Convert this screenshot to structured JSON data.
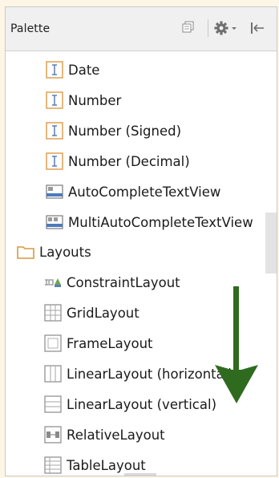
{
  "panel": {
    "title": "Palette",
    "toolbar": {
      "copy_icon": "copy-icon",
      "settings_icon": "gear-dropdown-icon",
      "hide_icon": "hide-panel-icon"
    }
  },
  "items": [
    {
      "label": "Date",
      "icon": "text-field-icon"
    },
    {
      "label": "Number",
      "icon": "text-field-icon"
    },
    {
      "label": "Number (Signed)",
      "icon": "text-field-icon"
    },
    {
      "label": "Number (Decimal)",
      "icon": "text-field-icon"
    },
    {
      "label": "AutoCompleteTextView",
      "icon": "autocomplete-icon"
    },
    {
      "label": "MultiAutoCompleteTextView",
      "icon": "multiautocomplete-icon"
    }
  ],
  "category": {
    "label": "Layouts",
    "icon": "folder-icon"
  },
  "layouts": [
    {
      "label": "ConstraintLayout",
      "icon": "constraint-layout-icon"
    },
    {
      "label": "GridLayout",
      "icon": "grid-layout-icon"
    },
    {
      "label": "FrameLayout",
      "icon": "frame-layout-icon"
    },
    {
      "label": "LinearLayout (horizontal)",
      "icon": "linear-horizontal-icon"
    },
    {
      "label": "LinearLayout (vertical)",
      "icon": "linear-vertical-icon"
    },
    {
      "label": "RelativeLayout",
      "icon": "relative-layout-icon"
    },
    {
      "label": "TableLayout",
      "icon": "table-layout-icon"
    }
  ],
  "annotation": {
    "arrow": "down-arrow-annotation",
    "color": "#2e6b1f"
  }
}
